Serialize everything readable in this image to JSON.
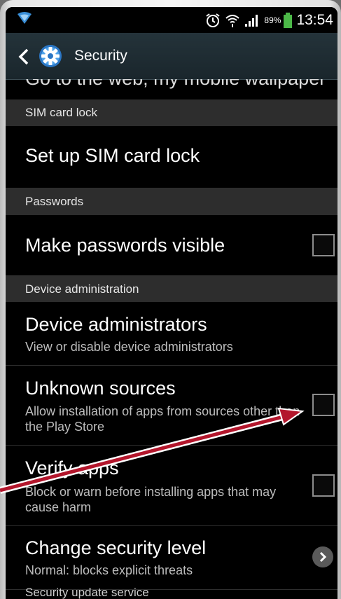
{
  "status_bar": {
    "battery_percent": "89%",
    "time": "13:54",
    "icons": [
      "signal-icon",
      "alarm-icon",
      "wifi-icon",
      "cell-signal-icon",
      "battery-icon"
    ]
  },
  "action_bar": {
    "title": "Security"
  },
  "cutoff_item": {
    "text": "Go to the web, my mobile wallpaper"
  },
  "sections": {
    "sim_header": "SIM card lock",
    "sim_item": "Set up SIM card lock",
    "passwords_header": "Passwords",
    "passwords_item": "Make passwords visible",
    "device_admin_header": "Device administration",
    "device_admins_title": "Device administrators",
    "device_admins_sub": "View or disable device administrators",
    "unknown_title": "Unknown sources",
    "unknown_sub": "Allow installation of apps from sources other than the Play Store",
    "verify_title": "Verify apps",
    "verify_sub": "Block or warn before installing apps that may cause harm",
    "security_level_title": "Change security level",
    "security_level_sub": "Normal: blocks explicit threats",
    "update_header": "Security update service"
  },
  "colors": {
    "arrow": "#b3162c",
    "actionbar": "#1f2d33",
    "header_bg": "#2d2d2d"
  }
}
